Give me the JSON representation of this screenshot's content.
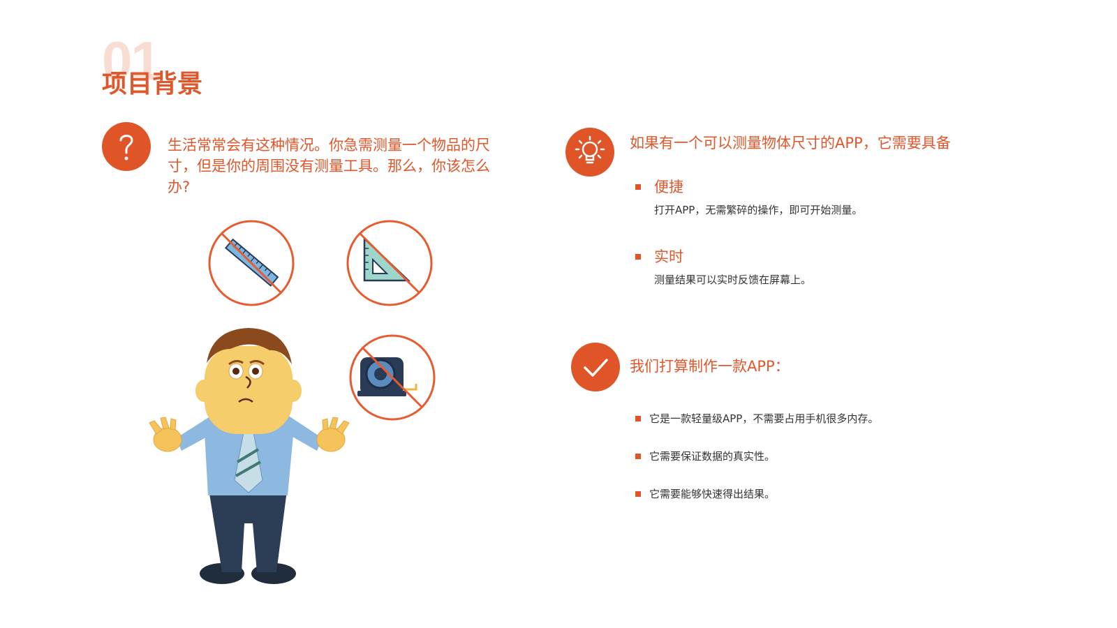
{
  "header": {
    "section_number": "01",
    "title": "项目背景"
  },
  "left": {
    "question_icon": "question-icon",
    "question_text": "生活常常会有这种情况。你急需测量一个物品的尺寸，但是你的周围没有测量工具。那么，你该怎么办?",
    "illustration_icons": [
      "no-ruler-icon",
      "no-triangle-ruler-icon",
      "no-tape-measure-icon",
      "confused-man-illustration"
    ]
  },
  "right": {
    "idea_icon": "lightbulb-icon",
    "idea_heading": "如果有一个可以测量物体尺寸的APP，它需要具备",
    "features": [
      {
        "title": "便捷",
        "desc": "打开APP，无需繁碎的操作，即可开始测量。"
      },
      {
        "title": "实时",
        "desc": "测量结果可以实时反馈在屏幕上。"
      }
    ],
    "plan_icon": "checkmark-icon",
    "plan_heading": "我们打算制作一款APP：",
    "plan_items": [
      "它是一款轻量级APP，不需要占用手机很多内存。",
      "它需要保证数据的真实性。",
      "它需要能够快速得出结果。"
    ]
  },
  "colors": {
    "accent": "#df5528",
    "faint_number": "#f9dcd2",
    "body_text": "#333333"
  }
}
